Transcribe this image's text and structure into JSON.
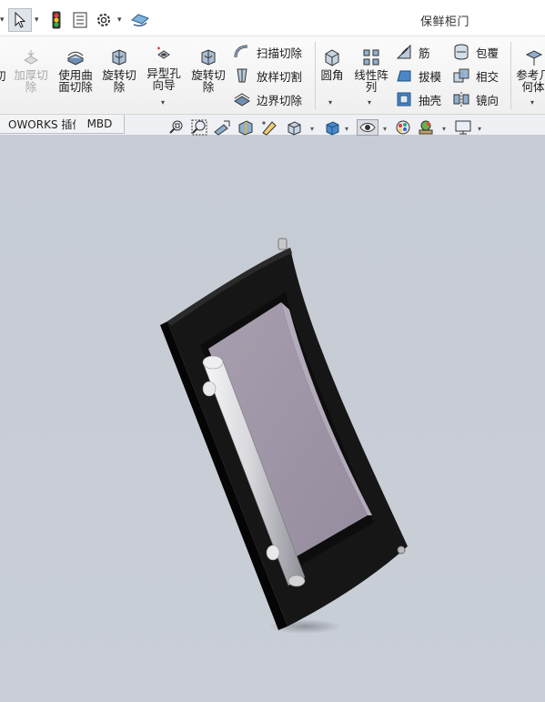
{
  "titlebar": {
    "document_title": "保鲜柜门"
  },
  "ribbon": {
    "thicken_cut": {
      "line1": "加厚切",
      "line2": "除"
    },
    "surface_cut": {
      "line1": "使用曲",
      "line2": "面切除"
    },
    "revolve_cut_1": {
      "line1": "旋转切",
      "line2": "除"
    },
    "hole_wizard": {
      "line1": "异型孔",
      "line2": "向导"
    },
    "revolve_cut_2": {
      "line1": "旋转切",
      "line2": "除"
    },
    "swept_cut": "扫描切除",
    "lofted_cut": "放样切割",
    "boundary_cut": "边界切除",
    "fillet": "圆角",
    "linear_pattern": {
      "line1": "线性阵",
      "line2": "列"
    },
    "rib": "筋",
    "draft": "拔模",
    "shell": "抽壳",
    "wrap": "包覆",
    "intersect": "相交",
    "mirror": "镜向",
    "ref_geometry": {
      "line1": "参考几",
      "line2": "何体"
    }
  },
  "tabs": {
    "addins": "OWORKS 插件",
    "mbd": "MBD"
  },
  "colors": {
    "viewport_bg": "#c8cdd6",
    "door_frame": "#151515",
    "glass": "#9e96a6",
    "handle": "#d9d9de"
  },
  "icons": [
    "select-arrow-icon",
    "traffic-light-icon",
    "property-manager-icon",
    "gear-icon",
    "rebuild-icon",
    "zoom-to-fit-icon",
    "zoom-area-icon",
    "previous-view-icon",
    "section-view-icon",
    "dynamic-annotation-icon",
    "view-orientation-icon",
    "display-style-icon",
    "hide-show-items-icon",
    "edit-appearance-icon",
    "apply-scene-icon",
    "view-settings-icon"
  ]
}
